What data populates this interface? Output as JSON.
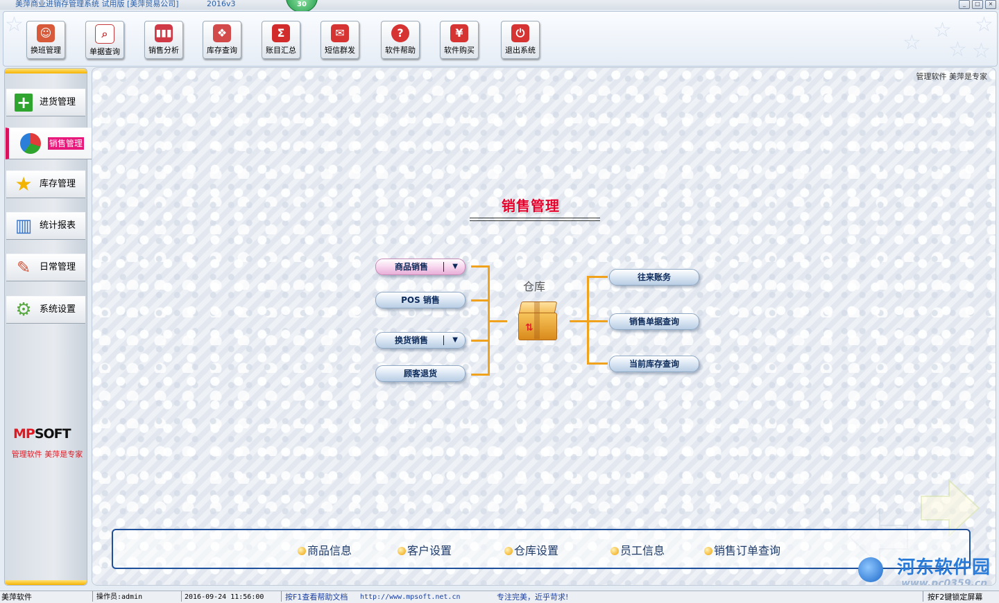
{
  "window": {
    "title": "美萍商业进销存管理系统 试用版 [美萍贸易公司]",
    "version": "2016v3",
    "badge": "30",
    "controls": [
      "_",
      "□",
      "×"
    ]
  },
  "toolbar": {
    "buttons": [
      {
        "label": "换班管理",
        "icon": "user-switch-icon",
        "color": "#d75a3a",
        "glyph": "☺"
      },
      {
        "label": "单据查询",
        "icon": "magnifier-icon",
        "color": "#c43a3a",
        "glyph": "🔍"
      },
      {
        "label": "销售分析",
        "icon": "bar-chart-icon",
        "color": "#d03a46",
        "glyph": "▮"
      },
      {
        "label": "库存查询",
        "icon": "boxes-icon",
        "color": "#d24a4a",
        "glyph": "❖"
      },
      {
        "label": "账目汇总",
        "icon": "sigma-icon",
        "color": "#d22b2b",
        "glyph": "Σ"
      },
      {
        "label": "短信群发",
        "icon": "envelope-icon",
        "color": "#d63333",
        "glyph": "✉"
      },
      {
        "label": "软件帮助",
        "icon": "help-icon",
        "color": "#d63333",
        "glyph": "?"
      },
      {
        "label": "软件购买",
        "icon": "yen-icon",
        "color": "#d63333",
        "glyph": "¥"
      },
      {
        "label": "退出系统",
        "icon": "power-icon",
        "color": "#d63333",
        "glyph": "⏻"
      }
    ]
  },
  "sidebar": {
    "items": [
      {
        "label": "进货管理",
        "icon": "green-plus-icon",
        "color": "#2fa52f",
        "glyph": "+"
      },
      {
        "label": "销售管理",
        "icon": "pie-chart-icon",
        "color": "#2c7fd9",
        "glyph": "◔",
        "active": true
      },
      {
        "label": "库存管理",
        "icon": "star-icon",
        "color": "#f2b400",
        "glyph": "★"
      },
      {
        "label": "统计报表",
        "icon": "column-chart-icon",
        "color": "#3b76c8",
        "glyph": "▥"
      },
      {
        "label": "日常管理",
        "icon": "tools-icon",
        "color": "#d2543a",
        "glyph": "✎"
      },
      {
        "label": "系统设置",
        "icon": "gear-icon",
        "color": "#58a840",
        "glyph": "⚙"
      }
    ],
    "logo": {
      "mp": "MP",
      "soft": "SOFT"
    },
    "logo_subtitle": "管理软件  美萍是专家"
  },
  "main": {
    "slogan": "管理软件  美萍是专家",
    "section_title": "销售管理",
    "warehouse_label": "仓库",
    "left_actions": [
      {
        "label": "商品销售",
        "dropdown": true
      },
      {
        "label": "POS 销售",
        "dropdown": false
      },
      {
        "label": "换货销售",
        "dropdown": true
      },
      {
        "label": "顾客退货",
        "dropdown": false
      }
    ],
    "right_actions": [
      {
        "label": "往来账务"
      },
      {
        "label": "销售单据查询"
      },
      {
        "label": "当前库存查询"
      }
    ],
    "bottom_links": [
      "商品信息",
      "客户设置",
      "仓库设置",
      "员工信息",
      "销售订单查询"
    ]
  },
  "watermark": {
    "text": "河东软件园",
    "url": "www.pc0359.cn"
  },
  "status_bar": {
    "company": "美萍软件",
    "operator": "操作员:admin",
    "datetime": "2016-09-24 11:56:00",
    "help": "按F1查看帮助文档",
    "website": "http://www.mpsoft.net.cn",
    "motto": "专注完美，近乎苛求!",
    "lock": "按F2键锁定屏幕"
  }
}
